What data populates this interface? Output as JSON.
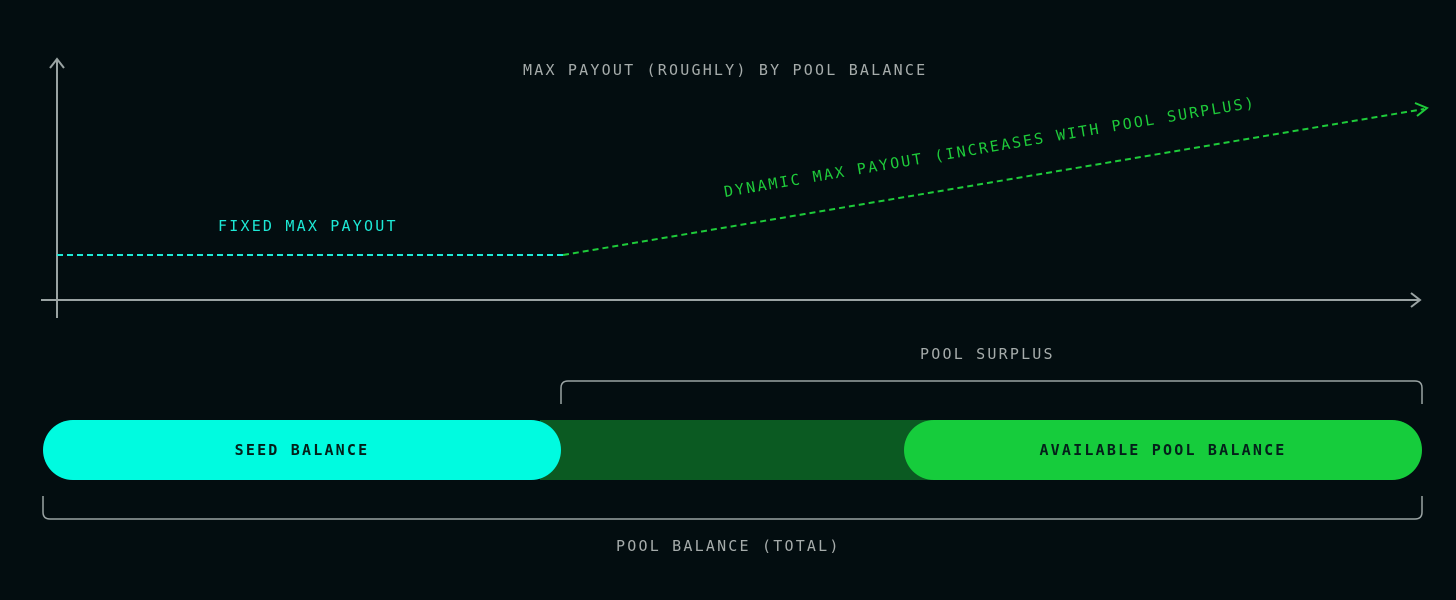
{
  "colors": {
    "background": "#030d10",
    "axis": "#9aa3a3",
    "fixed": "#1de9d6",
    "dynamic": "#1ecb3a",
    "seed_pill": "#00fbe0",
    "surplus_region": "#0b5a22",
    "available_pill": "#16cc3c",
    "muted_text": "#a6acab"
  },
  "chart": {
    "title": "MAX PAYOUT (ROUGHLY) BY POOL BALANCE",
    "fixed_label": "FIXED MAX PAYOUT",
    "dynamic_label": "DYNAMIC MAX PAYOUT (INCREASES WITH POOL SURPLUS)"
  },
  "bar": {
    "seed_label": "SEED BALANCE",
    "available_label": "AVAILABLE POOL BALANCE",
    "surplus_label": "POOL SURPLUS",
    "total_label": "POOL BALANCE (TOTAL)"
  }
}
